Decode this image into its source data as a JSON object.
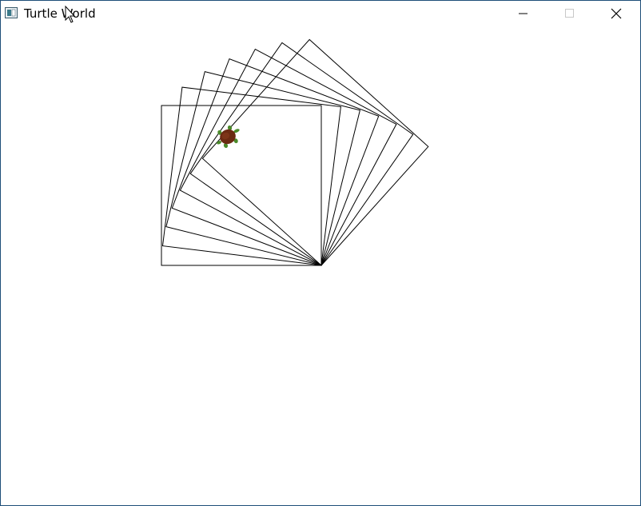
{
  "window": {
    "title": "Turtle World",
    "controls": {
      "minimize_icon": "minimize-icon",
      "maximize_icon": "maximize-icon",
      "close_icon": "close-icon"
    },
    "border_color": "#1f4e79"
  },
  "canvas": {
    "background": "#ffffff",
    "stroke_color": "#000000",
    "squares": 7,
    "turtle": {
      "shell_color": "#6b2a12",
      "limb_color": "#4a8a2a"
    }
  }
}
